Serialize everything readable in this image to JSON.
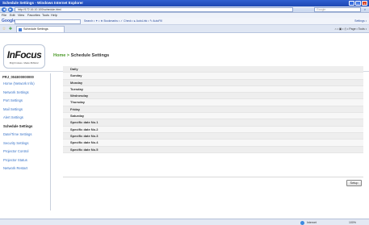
{
  "window": {
    "title": "Schedule Settings - Windows Internet Explorer",
    "minimize": "_",
    "maximize": "□",
    "close": "×"
  },
  "address": {
    "back": "◀",
    "forward": "▶",
    "url": "http://172.16.10.100/schedule.html",
    "search_placeholder": "Google",
    "go": "⌕"
  },
  "menu": [
    "File",
    "Edit",
    "View",
    "Favorites",
    "Tools",
    "Help"
  ],
  "google": {
    "logo": "Google",
    "tools": "Search • ✦ • ★ Bookmarks • ✓ Check • ▸ AutoLink • ✎ AutoFill",
    "settings": "Settings •"
  },
  "tabs": {
    "favorites_star": "☆",
    "add_favorites": "✚",
    "active_tab": "Schedule Settings",
    "ie_tools": "⌂ • ▣ • ⎙ • Page • Tools •"
  },
  "header": {
    "logo": "InFocus",
    "tagline": "Bright ideas. Made Brilliant.",
    "breadcrumb_home": "Home",
    "breadcrumb_sep": " > ",
    "breadcrumb_current": "Schedule Settings"
  },
  "sidebar": {
    "project": "PRJ_004E00000000",
    "items": [
      {
        "label": "Home (Network Info)"
      },
      {
        "label": "Network Settings"
      },
      {
        "label": "Port Settings"
      },
      {
        "label": "Mail Settings"
      },
      {
        "label": "Alert Settings"
      },
      {
        "label": "Schedule Settings"
      },
      {
        "label": "Date/Time Settings"
      },
      {
        "label": "Security Settings"
      },
      {
        "label": "Projector Control"
      },
      {
        "label": "Projector Status"
      },
      {
        "label": "Network Restart"
      }
    ],
    "active_index": 5
  },
  "schedule": {
    "rows": [
      "Daily",
      "Sunday",
      "Monday",
      "Tuesday",
      "Wednesday",
      "Thursday",
      "Friday",
      "Saturday",
      "Specific date No.1",
      "Specific date No.2",
      "Specific date No.3",
      "Specific date No.4",
      "Specific date No.5"
    ],
    "button": "Setup"
  },
  "status": {
    "zone": "Internet",
    "zoom": "100%"
  },
  "colors": {
    "link": "#3a74c8",
    "breadcrumb_home": "#4c9a2a",
    "titlebar": "#2f5fd0"
  }
}
